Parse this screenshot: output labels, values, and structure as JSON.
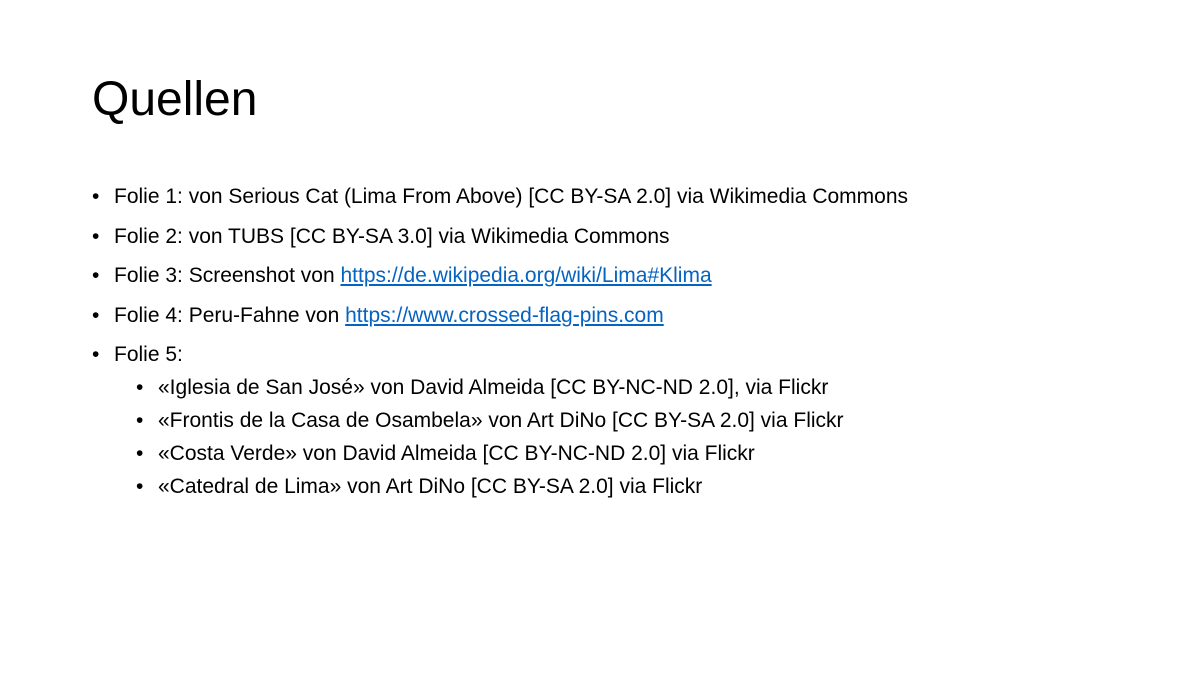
{
  "slide": {
    "title": "Quellen",
    "items": [
      {
        "bullet": "•",
        "text": "Folie 1: von Serious Cat (Lima From Above) [CC BY-SA 2.0] via Wikimedia Commons"
      },
      {
        "bullet": "•",
        "text": "Folie 2: von TUBS [CC BY-SA 3.0] via Wikimedia Commons"
      },
      {
        "bullet": "•",
        "text": "Folie 3: Screenshot von ",
        "link": "https://de.wikipedia.org/wiki/Lima#Klima"
      },
      {
        "bullet": "•",
        "text": "Folie 4: Peru-Fahne von ",
        "link": "https://www.crossed-flag-pins.com"
      },
      {
        "bullet": "•",
        "text": "Folie 5:",
        "subitems": [
          {
            "bullet": "•",
            "text": "«Iglesia de San José» von David Almeida [CC BY-NC-ND 2.0], via Flickr"
          },
          {
            "bullet": "•",
            "text": "«Frontis de la Casa de Osambela» von Art DiNo [CC BY-SA 2.0] via Flickr"
          },
          {
            "bullet": "•",
            "text": "«Costa Verde» von David Almeida [CC BY-NC-ND 2.0] via Flickr"
          },
          {
            "bullet": "•",
            "text": "«Catedral de Lima» von Art DiNo [CC BY-SA 2.0] via Flickr"
          }
        ]
      }
    ]
  },
  "colors": {
    "background": "#ffffff",
    "text": "#000000",
    "link": "#0563c1"
  }
}
